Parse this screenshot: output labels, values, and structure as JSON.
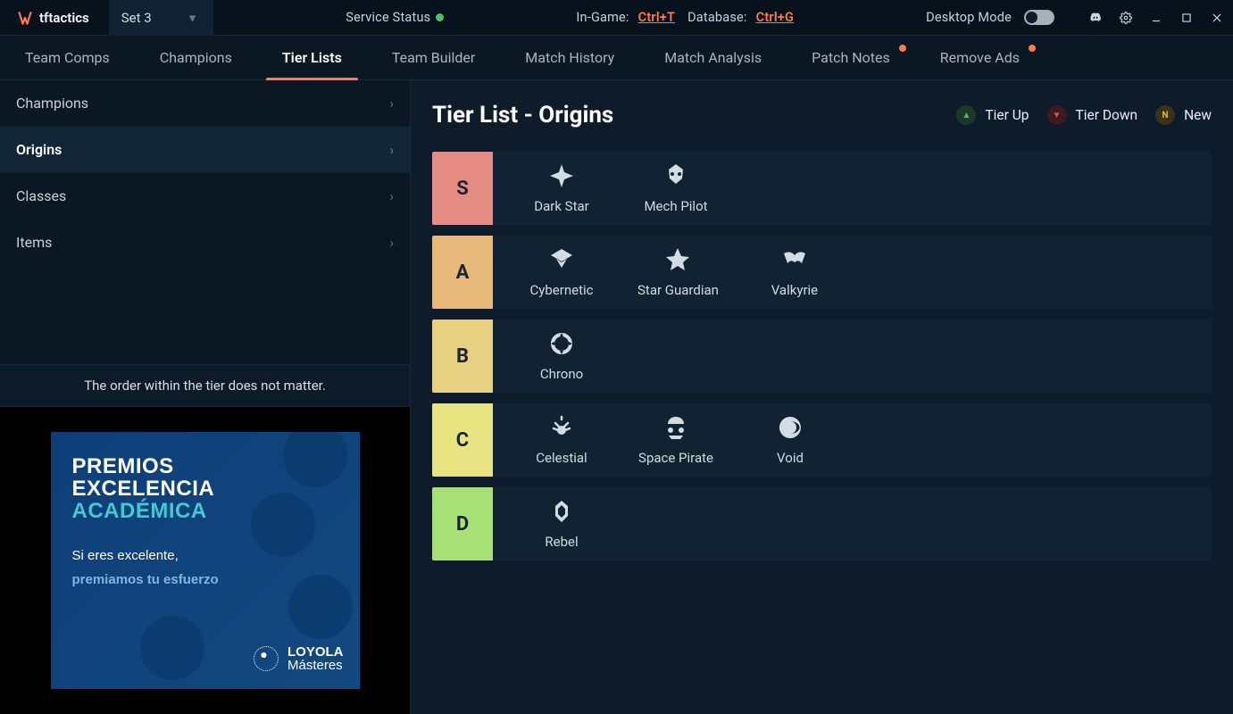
{
  "app": {
    "name": "tftactics",
    "set_label": "Set 3"
  },
  "status": {
    "service_label": "Service Status",
    "service_color": "#4cc069",
    "ingame_label": "In-Game:",
    "ingame_shortcut": "Ctrl+T",
    "database_label": "Database:",
    "database_shortcut": "Ctrl+G",
    "desktop_label": "Desktop Mode"
  },
  "nav": [
    {
      "label": "Team Comps",
      "active": false,
      "notif": false
    },
    {
      "label": "Champions",
      "active": false,
      "notif": false
    },
    {
      "label": "Tier Lists",
      "active": true,
      "notif": false
    },
    {
      "label": "Team Builder",
      "active": false,
      "notif": false
    },
    {
      "label": "Match History",
      "active": false,
      "notif": false
    },
    {
      "label": "Match Analysis",
      "active": false,
      "notif": false
    },
    {
      "label": "Patch Notes",
      "active": false,
      "notif": true
    },
    {
      "label": "Remove Ads",
      "active": false,
      "notif": true
    }
  ],
  "sidebar": {
    "items": [
      {
        "label": "Champions",
        "selected": false
      },
      {
        "label": "Origins",
        "selected": true
      },
      {
        "label": "Classes",
        "selected": false
      },
      {
        "label": "Items",
        "selected": false
      }
    ],
    "note": "The order within the tier does not matter."
  },
  "ad": {
    "title_line1": "PREMIOS",
    "title_line2": "EXCELENCIA",
    "title_line3": "ACADÉMICA",
    "sub1": "Si eres excelente,",
    "sub2": "premiamos tu esfuerzo",
    "brand1": "LOYOLA",
    "brand2": "Másteres"
  },
  "content": {
    "title": "Tier List - Origins",
    "legend": {
      "up": "Tier Up",
      "down": "Tier Down",
      "new": "New",
      "new_badge": "N"
    },
    "tiers": [
      {
        "rank": "S",
        "color": "#e58c84",
        "items": [
          "Dark Star",
          "Mech Pilot"
        ]
      },
      {
        "rank": "A",
        "color": "#e6b87a",
        "items": [
          "Cybernetic",
          "Star Guardian",
          "Valkyrie"
        ]
      },
      {
        "rank": "B",
        "color": "#e8d083",
        "items": [
          "Chrono"
        ]
      },
      {
        "rank": "C",
        "color": "#e8e483",
        "items": [
          "Celestial",
          "Space Pirate",
          "Void"
        ]
      },
      {
        "rank": "D",
        "color": "#a7e077",
        "items": [
          "Rebel"
        ]
      }
    ]
  },
  "icons": {
    "Dark Star": "darkstar",
    "Mech Pilot": "mech",
    "Cybernetic": "cyber",
    "Star Guardian": "starguardian",
    "Valkyrie": "valkyrie",
    "Chrono": "chrono",
    "Celestial": "celestial",
    "Space Pirate": "pirate",
    "Void": "void",
    "Rebel": "rebel"
  }
}
